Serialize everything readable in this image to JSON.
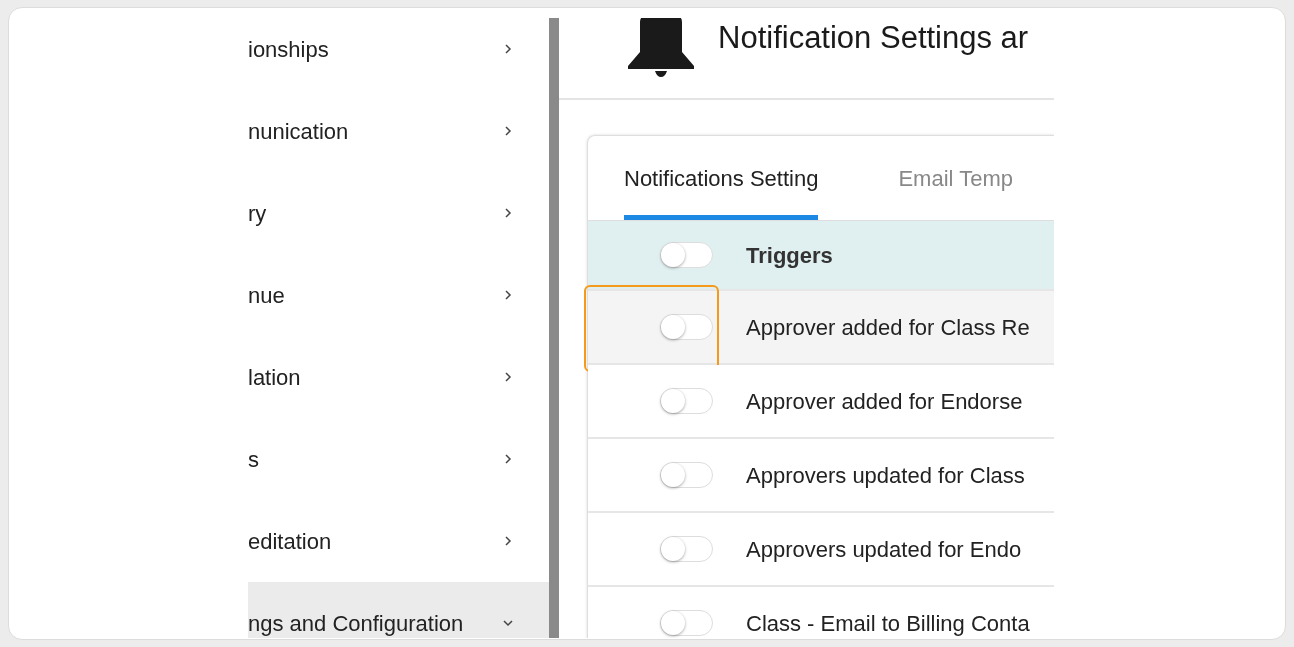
{
  "sidebar": {
    "items": [
      {
        "label": "ionships",
        "selected": false,
        "expanded": false
      },
      {
        "label": "nunication",
        "selected": false,
        "expanded": false
      },
      {
        "label": "ry",
        "selected": false,
        "expanded": false
      },
      {
        "label": "nue",
        "selected": false,
        "expanded": false
      },
      {
        "label": "lation",
        "selected": false,
        "expanded": false
      },
      {
        "label": "s",
        "selected": false,
        "expanded": false
      },
      {
        "label": "editation",
        "selected": false,
        "expanded": false
      },
      {
        "label": "ngs and Configuration",
        "selected": true,
        "expanded": true
      }
    ]
  },
  "header": {
    "title": "Notification Settings ar"
  },
  "tabs": [
    {
      "label": "Notifications Setting",
      "selected": true
    },
    {
      "label": "Email Temp",
      "selected": false
    }
  ],
  "table": {
    "header": {
      "label": "Triggers",
      "on": false
    },
    "rows": [
      {
        "label": "Approver added for Class Re",
        "on": false,
        "highlighted": true
      },
      {
        "label": "Approver added for Endorse",
        "on": false,
        "highlighted": false
      },
      {
        "label": "Approvers updated for Class",
        "on": false,
        "highlighted": false
      },
      {
        "label": "Approvers updated for Endo",
        "on": false,
        "highlighted": false
      },
      {
        "label": "Class - Email to Billing Conta",
        "on": false,
        "highlighted": false
      }
    ]
  }
}
